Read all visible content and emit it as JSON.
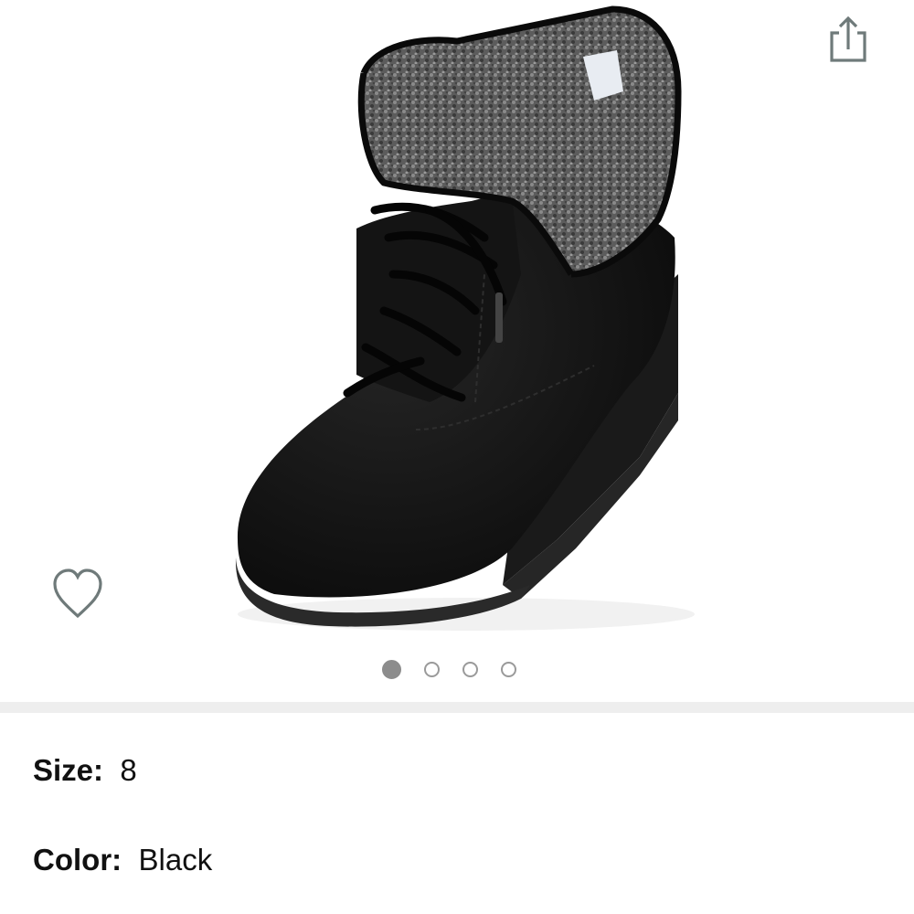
{
  "gallery": {
    "image_alt": "Black suede lace-up wedge ankle boot with grey shearling fold-over cuff",
    "share_icon": "share-icon",
    "wishlist_icon": "heart-outline-icon",
    "pagination": {
      "total": 4,
      "active_index": 0
    }
  },
  "details": {
    "size": {
      "label": "Size:",
      "value": "8"
    },
    "color": {
      "label": "Color:",
      "value": "Black"
    }
  },
  "colors": {
    "icon_gray": "#6f7a7a",
    "dot_active": "#8c8c8c",
    "dot_inactive_border": "#9a9a9a",
    "divider": "#eeeeee",
    "text": "#111111"
  }
}
